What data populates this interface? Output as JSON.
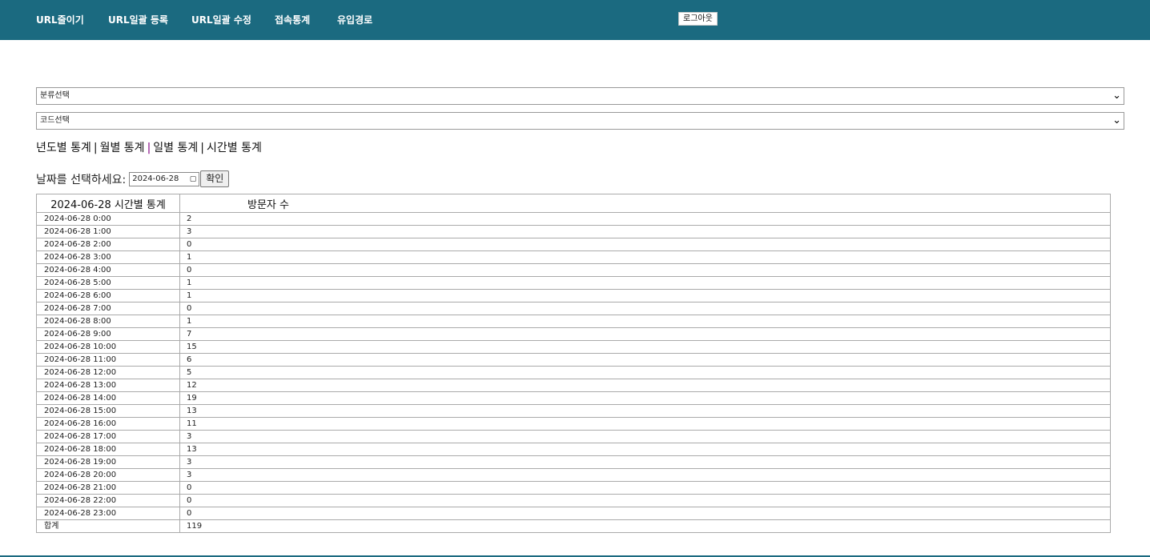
{
  "nav": {
    "items": [
      "URL줄이기",
      "URL일괄 등록",
      "URL일괄 수정",
      "접속통계",
      "유입경로"
    ],
    "logout": "로그아웃"
  },
  "filters": {
    "category_select": "분류선택",
    "code_select": "코드선택"
  },
  "stat_links": {
    "yearly": "년도별 통계",
    "monthly": "월별 통계",
    "daily": "일별 통계",
    "hourly": "시간별 통계",
    "separator": "|"
  },
  "date_picker": {
    "label": "날짜를 선택하세요:",
    "value": "2024-06-28",
    "confirm": "확인"
  },
  "table": {
    "headers": [
      "2024-06-28 시간별 통계",
      "방문자 수"
    ],
    "rows": [
      {
        "time": "2024-06-28 0:00",
        "count": "2"
      },
      {
        "time": "2024-06-28 1:00",
        "count": "3"
      },
      {
        "time": "2024-06-28 2:00",
        "count": "0"
      },
      {
        "time": "2024-06-28 3:00",
        "count": "1"
      },
      {
        "time": "2024-06-28 4:00",
        "count": "0"
      },
      {
        "time": "2024-06-28 5:00",
        "count": "1"
      },
      {
        "time": "2024-06-28 6:00",
        "count": "1"
      },
      {
        "time": "2024-06-28 7:00",
        "count": "0"
      },
      {
        "time": "2024-06-28 8:00",
        "count": "1"
      },
      {
        "time": "2024-06-28 9:00",
        "count": "7"
      },
      {
        "time": "2024-06-28 10:00",
        "count": "15"
      },
      {
        "time": "2024-06-28 11:00",
        "count": "6"
      },
      {
        "time": "2024-06-28 12:00",
        "count": "5"
      },
      {
        "time": "2024-06-28 13:00",
        "count": "12"
      },
      {
        "time": "2024-06-28 14:00",
        "count": "19"
      },
      {
        "time": "2024-06-28 15:00",
        "count": "13"
      },
      {
        "time": "2024-06-28 16:00",
        "count": "11"
      },
      {
        "time": "2024-06-28 17:00",
        "count": "3"
      },
      {
        "time": "2024-06-28 18:00",
        "count": "13"
      },
      {
        "time": "2024-06-28 19:00",
        "count": "3"
      },
      {
        "time": "2024-06-28 20:00",
        "count": "3"
      },
      {
        "time": "2024-06-28 21:00",
        "count": "0"
      },
      {
        "time": "2024-06-28 22:00",
        "count": "0"
      },
      {
        "time": "2024-06-28 23:00",
        "count": "0"
      }
    ],
    "total_label": "합계",
    "total_value": "119"
  },
  "colors": {
    "header_bg": "#1b6a80",
    "link_separator_accent": "#800080"
  }
}
